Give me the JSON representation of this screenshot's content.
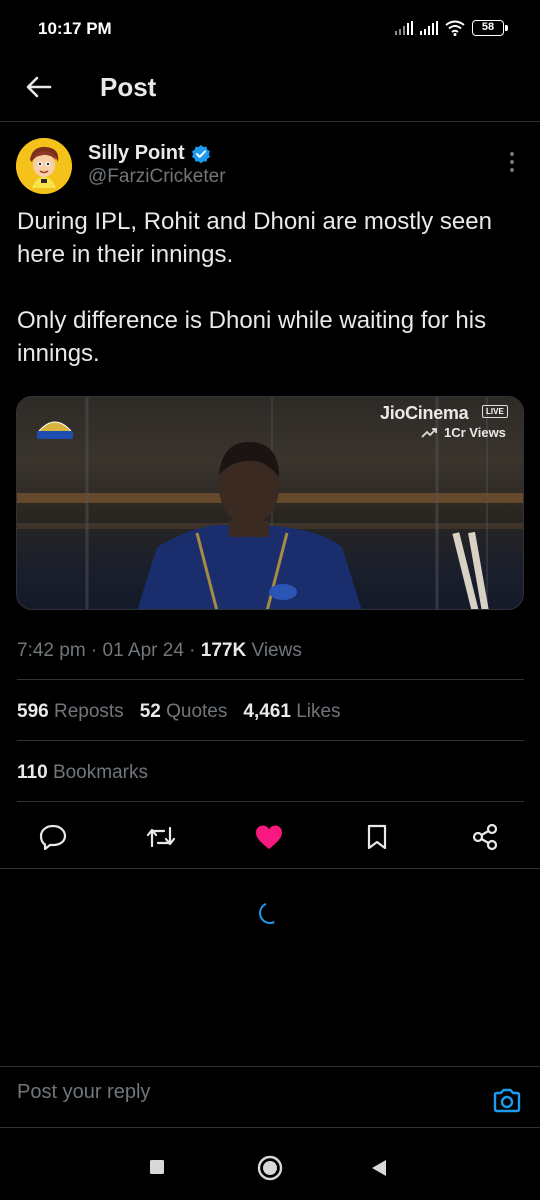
{
  "status_bar": {
    "time": "10:17 PM",
    "battery": "58"
  },
  "header": {
    "title": "Post"
  },
  "author": {
    "name": "Silly Point",
    "handle": "@FarziCricketer"
  },
  "post": {
    "paragraphs": [
      "During IPL, Rohit and Dhoni are mostly seen here in their innings.",
      "Only difference is Dhoni while waiting for his innings."
    ]
  },
  "media": {
    "broadcaster": "JioCinema",
    "live_badge": "LIVE",
    "views_overlay": "1Cr Views",
    "team_logo_text": "MUMBAI INDIANS"
  },
  "meta": {
    "time": "7:42 pm",
    "date": "01 Apr 24",
    "views_count": "177K",
    "views_label": "Views"
  },
  "stats": {
    "reposts_count": "596",
    "reposts_label": "Reposts",
    "quotes_count": "52",
    "quotes_label": "Quotes",
    "likes_count": "4,461",
    "likes_label": "Likes",
    "bookmarks_count": "110",
    "bookmarks_label": "Bookmarks"
  },
  "actions": [
    "reply-icon",
    "repost-icon",
    "like-icon",
    "bookmark-icon",
    "share-icon"
  ],
  "reply": {
    "placeholder": "Post your reply"
  },
  "colors": {
    "accent": "#1d9bf0",
    "like": "#f91880",
    "muted": "#71767b",
    "text": "#e7e9ea",
    "border": "#2f3336"
  }
}
